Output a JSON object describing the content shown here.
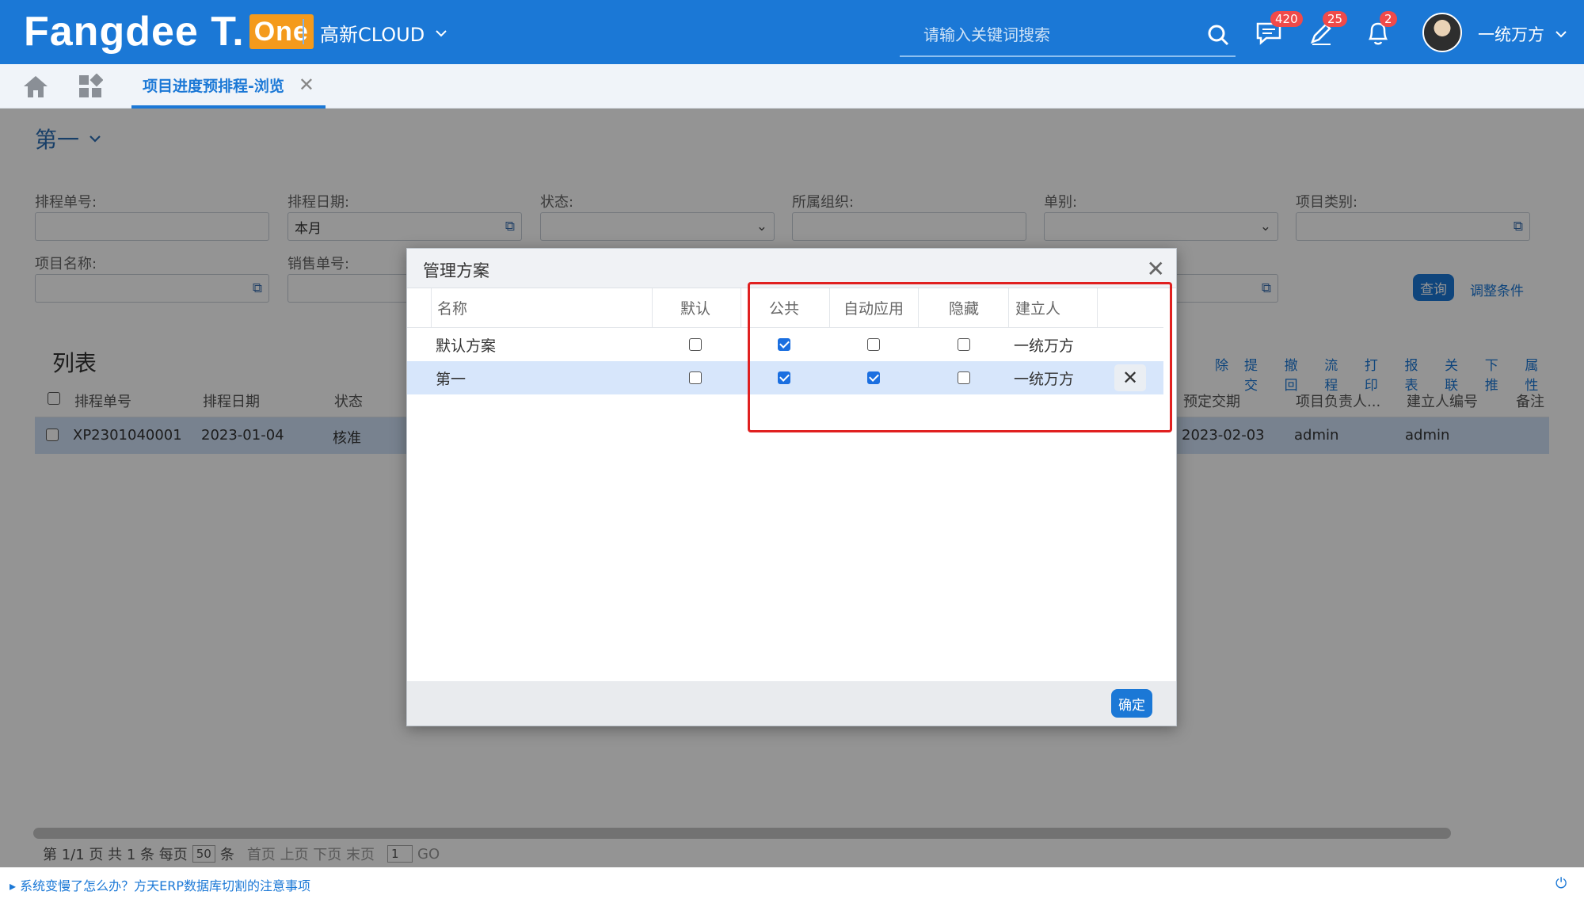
{
  "header": {
    "logo_text": "Fangdee T.",
    "logo_badge": "One",
    "company": "高新CLOUD",
    "search_placeholder": "请输入关键词搜索",
    "badges": {
      "messages": "420",
      "edits": "25",
      "notifications": "2"
    },
    "username": "一统万方"
  },
  "tabs": [
    {
      "label": "项目进度预排程-浏览"
    }
  ],
  "page": {
    "scheme_name": "第一",
    "filters": {
      "schedule_no": "排程单号:",
      "schedule_date": "排程日期:",
      "schedule_date_value": "本月",
      "status": "状态:",
      "org": "所属组织:",
      "doc_type": "单别:",
      "project_type": "项目类别:",
      "project_name": "项目名称:",
      "sales_no": "销售单号:"
    },
    "query_button": "查询",
    "adjust_link": "调整条件",
    "list_title": "列表",
    "toolbar": [
      "除",
      "提交",
      "撤回",
      "流程",
      "打印",
      "报表",
      "关联",
      "下推",
      "属性"
    ],
    "columns": [
      "排程单号",
      "排程日期",
      "状态",
      "预定交期",
      "项目负责人...",
      "建立人编号",
      "备注"
    ],
    "rows": [
      {
        "no": "XP2301040001",
        "date": "2023-01-04",
        "status": "核准",
        "due": "2023-02-03",
        "owner": "admin",
        "creator_no": "admin"
      }
    ],
    "pager": {
      "text1": "第 1/1 页 共 1 条 每页",
      "size": "50",
      "text2": "条",
      "nav": "首页 上页 下页 末页",
      "page_input": "1",
      "go": "GO"
    },
    "footer_link": "系统变慢了怎么办？方天ERP数据库切割的注意事项"
  },
  "modal": {
    "title": "管理方案",
    "columns": {
      "name": "名称",
      "default": "默认",
      "public": "公共",
      "auto": "自动应用",
      "hidden": "隐藏",
      "creator": "建立人"
    },
    "rows": [
      {
        "name": "默认方案",
        "default": false,
        "public": true,
        "auto": false,
        "hidden": false,
        "creator": "一统万方",
        "deletable": false
      },
      {
        "name": "第一",
        "default": false,
        "public": true,
        "auto": true,
        "hidden": false,
        "creator": "一统万方",
        "deletable": true
      }
    ],
    "ok_button": "确定"
  },
  "colors": {
    "brand": "#1b78d6",
    "highlight": "#e02020",
    "selected_row": "#d7e6fb"
  }
}
